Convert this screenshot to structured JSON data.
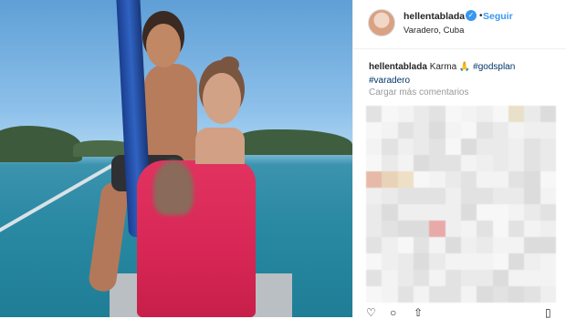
{
  "post": {
    "username": "hellentablada",
    "verified_icon": "verified-badge-icon",
    "follow_label": "Seguir",
    "location": "Varadero, Cuba",
    "caption": {
      "author": "hellentablada",
      "text": "Karma",
      "emoji": "🙏",
      "hashtags": [
        "#godsplan",
        "#varadero"
      ]
    },
    "load_more_label": "Cargar más comentarios",
    "action_icons": [
      "heart-icon",
      "comment-icon",
      "share-icon",
      "bookmark-icon"
    ]
  },
  "colors": {
    "accent": "#3897f0",
    "hashtag": "#003569",
    "muted": "#999999",
    "dress": "#d72655"
  }
}
